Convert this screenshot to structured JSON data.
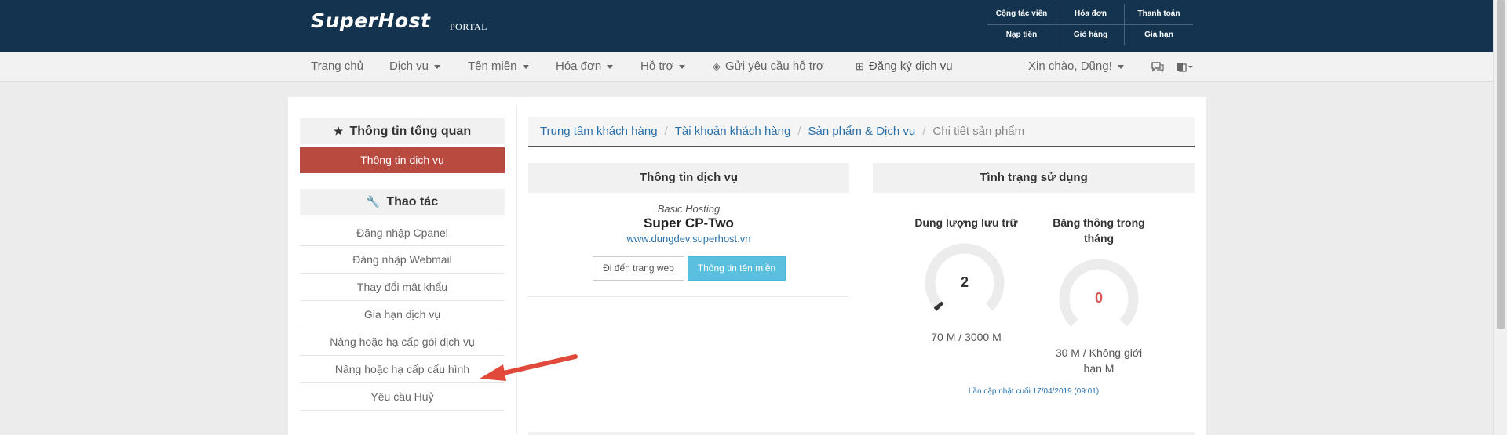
{
  "brand": {
    "logo": "SuperHost",
    "sub": "PORTAL"
  },
  "top_links": [
    {
      "label": "Cộng tác viên"
    },
    {
      "label": "Hóa đơn"
    },
    {
      "label": "Thanh toán"
    },
    {
      "label": "Nạp tiền"
    },
    {
      "label": "Giỏ hàng"
    },
    {
      "label": "Gia hạn"
    }
  ],
  "nav": {
    "home": "Trang chủ",
    "services": "Dịch vụ",
    "domains": "Tên miền",
    "invoices": "Hóa đơn",
    "support": "Hỗ trợ",
    "ticket": "Gửi yêu cầu hỗ trợ",
    "register": "Đăng ký dịch vụ",
    "greeting": "Xin chào, Dũng!"
  },
  "sidebar": {
    "overview_heading": "Thông tin tổng quan",
    "active_item": "Thông tin dịch vụ",
    "actions_heading": "Thao tác",
    "actions": [
      {
        "label": "Đăng nhập Cpanel"
      },
      {
        "label": "Đăng nhập Webmail"
      },
      {
        "label": "Thay đổi mật khẩu"
      },
      {
        "label": "Gia hạn dịch vụ"
      },
      {
        "label": "Nâng hoặc hạ cấp gói dịch vụ"
      },
      {
        "label": "Nâng hoặc hạ cấp cấu hình"
      },
      {
        "label": "Yêu cầu Huỷ"
      }
    ]
  },
  "breadcrumb": {
    "items": [
      "Trung tâm khách hàng",
      "Tài khoản khách hàng",
      "Sản phẩm & Dịch vụ"
    ],
    "current": "Chi tiết sản phẩm"
  },
  "service": {
    "heading": "Thông tin dịch vụ",
    "type": "Basic Hosting",
    "name": "Super CP-Two",
    "domain": "www.dungdev.superhost.vn",
    "visit_button": "Đi đến trang web",
    "domain_info_button": "Thông tin tên miền"
  },
  "usage": {
    "heading": "Tình trạng sử dụng",
    "disk": {
      "label": "Dung lượng lưu trữ",
      "value": "2",
      "detail": "70 M / 3000 M",
      "percent": 2.3
    },
    "bandwidth": {
      "label_line1": "Băng thông trong",
      "label_line2": "tháng",
      "value": "0",
      "detail_line1": "30 M / Không giới",
      "detail_line2": "hạn M",
      "percent": 0
    },
    "updated": "Lần cập nhật cuối 17/04/2019 (09:01)"
  },
  "colors": {
    "header": "#13334f",
    "accent_red": "#b94a40",
    "info": "#5bc0de",
    "link": "#2a6fa8"
  }
}
